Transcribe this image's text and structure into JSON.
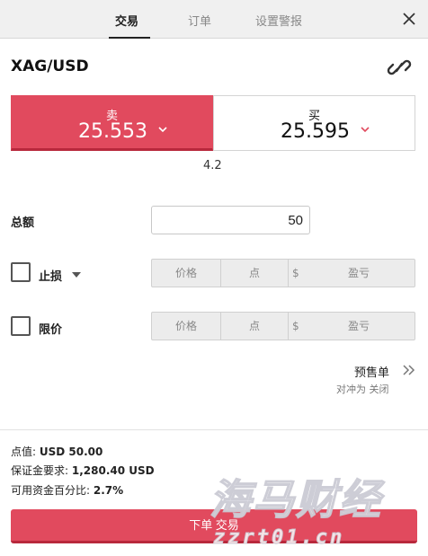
{
  "tabs": [
    {
      "label": "交易",
      "active": true
    },
    {
      "label": "订单",
      "active": false
    },
    {
      "label": "设置警报",
      "active": false
    }
  ],
  "symbol": "XAG/USD",
  "icons": {
    "close": "close-icon",
    "link": "link-icon",
    "chevron": "chevron-down-icon",
    "double_chevron": "double-chevron-right-icon"
  },
  "sell": {
    "label": "卖",
    "price": "25.553",
    "color": "#e14a5e"
  },
  "buy": {
    "label": "买",
    "price": "25.595",
    "chevron_color": "#e14a5e"
  },
  "spread": "4.2",
  "amount": {
    "label": "总额",
    "value": "50"
  },
  "stop_loss": {
    "label": "止损",
    "checked": false,
    "fields": {
      "price": "价格",
      "points": "点",
      "currency": "$",
      "pnl": "盈亏"
    }
  },
  "limit": {
    "label": "限价",
    "checked": false,
    "fields": {
      "price": "价格",
      "points": "点",
      "currency": "$",
      "pnl": "盈亏"
    }
  },
  "preorder": {
    "label": "预售单",
    "oco": "对冲为 关闭"
  },
  "info": {
    "pip_label": "点值: ",
    "pip_value": "USD 50.00",
    "margin_label": "保证金要求: ",
    "margin_value": "1,280.40 USD",
    "funds_label": "可用资金百分比: ",
    "funds_value": "2.7%"
  },
  "submit": {
    "label": "下单 交易"
  },
  "watermark": {
    "text": "海马财经",
    "url": "zzrt01.cn"
  }
}
